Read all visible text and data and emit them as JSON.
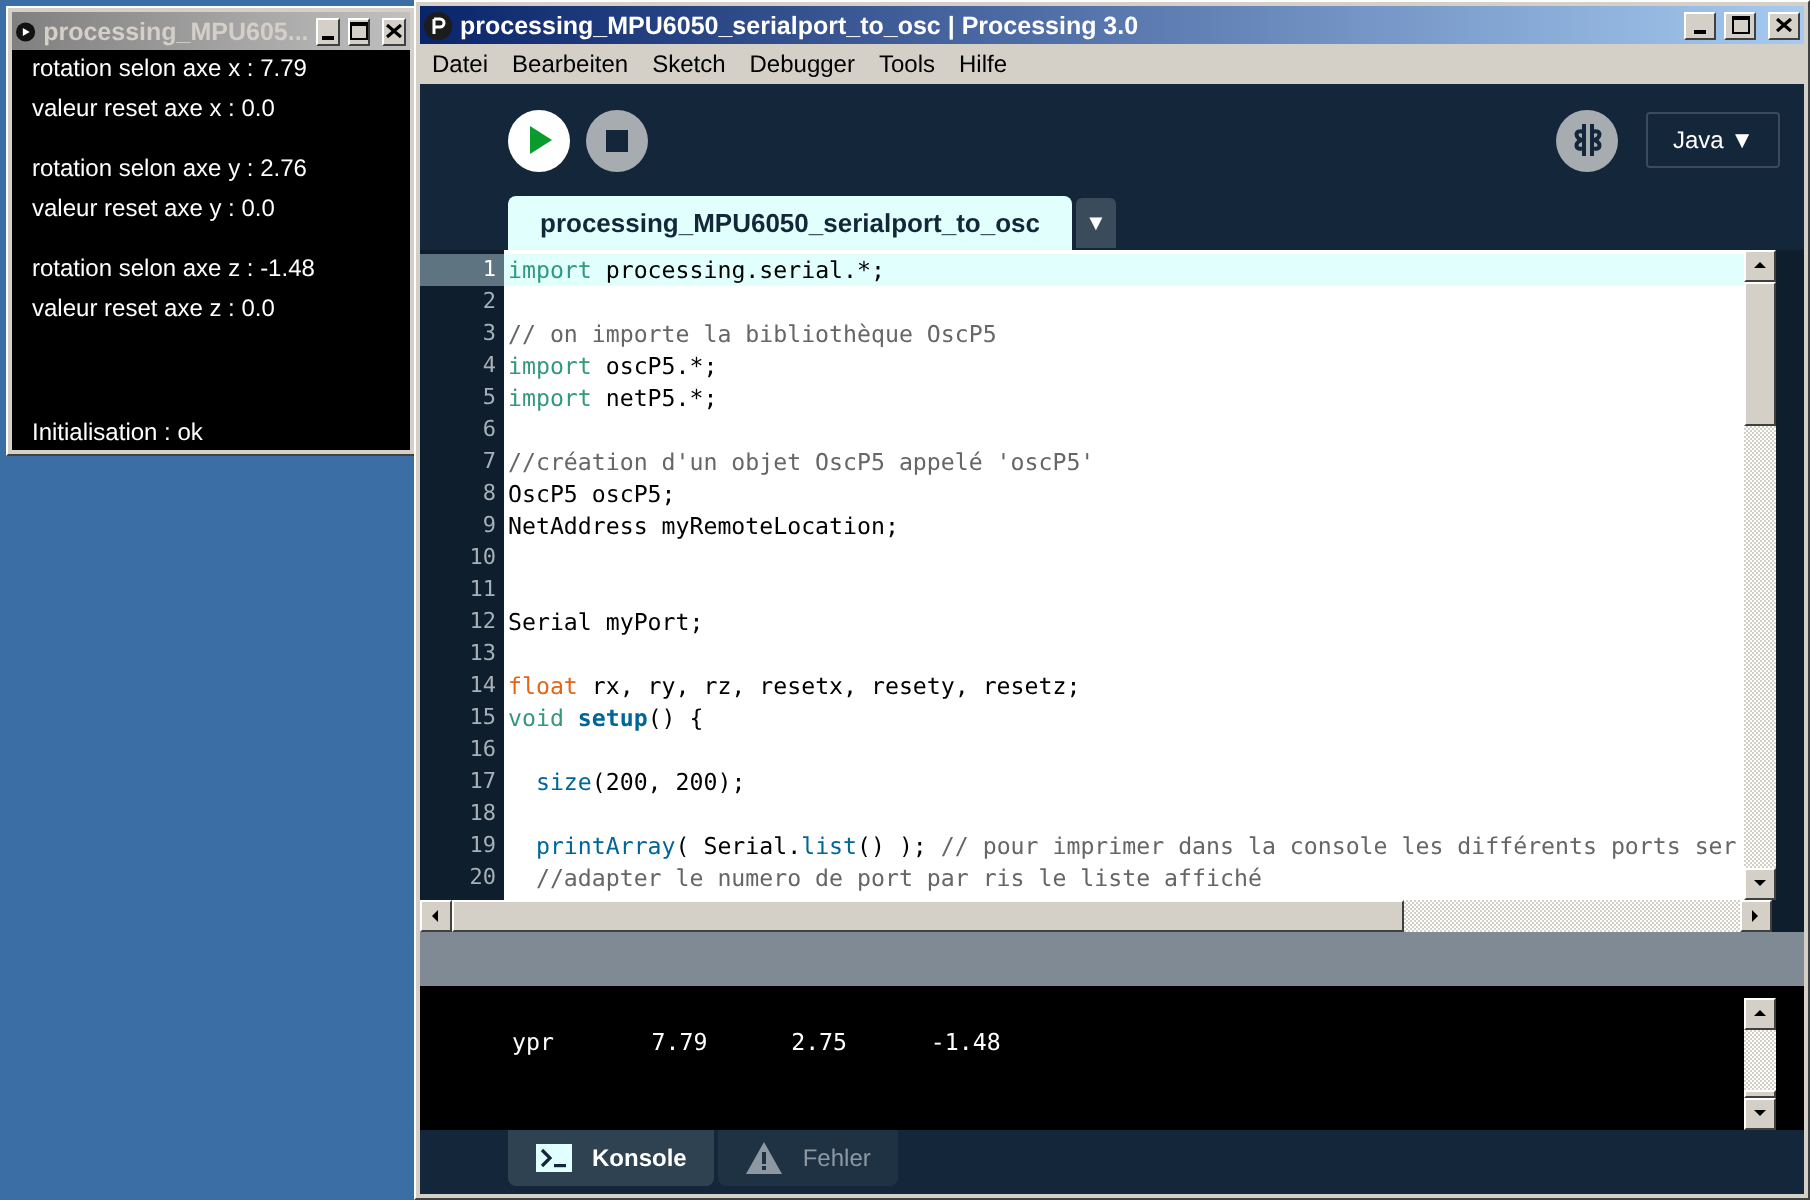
{
  "sketch_window": {
    "title": "processing_MPU605...",
    "groups": [
      [
        "rotation selon axe x : 7.79",
        "valeur reset axe x : 0.0"
      ],
      [
        "rotation selon axe y : 2.76",
        "valeur reset  axe y : 0.0"
      ],
      [
        "rotation selon axe z : -1.48",
        "valeur reset  axe z : 0.0"
      ]
    ],
    "status": "Initialisation : ok"
  },
  "ide_window": {
    "title": "processing_MPU6050_serialport_to_osc | Processing 3.0",
    "menu": [
      "Datei",
      "Bearbeiten",
      "Sketch",
      "Debugger",
      "Tools",
      "Hilfe"
    ],
    "mode": "Java ▼",
    "tabs": [
      {
        "label": "processing_MPU6050_serialport_to_osc",
        "selected": true
      }
    ],
    "tab_menu": "▼",
    "code_lines": [
      {
        "number": "1",
        "current": true,
        "tokens": [
          {
            "text": "import",
            "kind": "keyword"
          },
          {
            "text": " processing.serial.*;",
            "kind": "plain"
          }
        ]
      },
      {
        "number": "2",
        "current": false
      },
      {
        "number": "3",
        "current": false,
        "tokens": [
          {
            "text": "// on importe la bibliothèque OscP5",
            "kind": "comment"
          }
        ]
      },
      {
        "number": "4",
        "current": false,
        "tokens": [
          {
            "text": "import",
            "kind": "keyword"
          },
          {
            "text": " oscP5.*;",
            "kind": "plain"
          }
        ]
      },
      {
        "number": "5",
        "current": false,
        "tokens": [
          {
            "text": "import",
            "kind": "keyword"
          },
          {
            "text": " netP5.*;",
            "kind": "plain"
          }
        ]
      },
      {
        "number": "6",
        "current": false
      },
      {
        "number": "7",
        "current": false,
        "tokens": [
          {
            "text": "//création d'un objet OscP5 appelé 'oscP5'",
            "kind": "comment"
          }
        ]
      },
      {
        "number": "8",
        "current": false,
        "tokens": [
          {
            "text": "OscP5 oscP5;",
            "kind": "plain"
          }
        ]
      },
      {
        "number": "9",
        "current": false,
        "tokens": [
          {
            "text": "NetAddress myRemoteLocation;",
            "kind": "plain"
          }
        ]
      },
      {
        "number": "10",
        "current": false
      },
      {
        "number": "11",
        "current": false
      },
      {
        "number": "12",
        "current": false,
        "tokens": [
          {
            "text": "Serial myPort;",
            "kind": "plain"
          }
        ]
      },
      {
        "number": "13",
        "current": false
      },
      {
        "number": "14",
        "current": false,
        "tokens": [
          {
            "text": "float",
            "kind": "type"
          },
          {
            "text": " rx, ry, rz, resetx, resety, resetz;",
            "kind": "plain"
          }
        ]
      },
      {
        "number": "15",
        "current": false,
        "tokens": [
          {
            "text": "void",
            "kind": "keyword"
          },
          {
            "text": " setup",
            "kind": "function"
          },
          {
            "text": "() {",
            "kind": "plain"
          }
        ]
      },
      {
        "number": "16",
        "current": false
      },
      {
        "number": "17",
        "current": false,
        "tokens": [
          {
            "text": "  size",
            "kind": "builtin"
          },
          {
            "text": "(200, 200);",
            "kind": "plain"
          }
        ]
      },
      {
        "number": "18",
        "current": false
      },
      {
        "number": "19",
        "current": false,
        "tokens": [
          {
            "text": "  printArray",
            "kind": "builtin"
          },
          {
            "text": "( Serial.",
            "kind": "plain"
          },
          {
            "text": "list",
            "kind": "builtin"
          },
          {
            "text": "() ); ",
            "kind": "plain"
          },
          {
            "text": "// pour imprimer dans la console les différents ports ser",
            "kind": "comment"
          }
        ]
      },
      {
        "number": "20",
        "current": false,
        "tokens": [
          {
            "text": "  //adapter le numero de port par ris le liste affiché",
            "kind": "comment"
          }
        ]
      }
    ],
    "console_lines": [
      "ypr       7.79      2.75      -1.48"
    ],
    "console_tabs": [
      {
        "label": "Konsole",
        "kind": "console",
        "selected": true
      },
      {
        "label": "Fehler",
        "kind": "errors",
        "selected": false
      }
    ]
  }
}
